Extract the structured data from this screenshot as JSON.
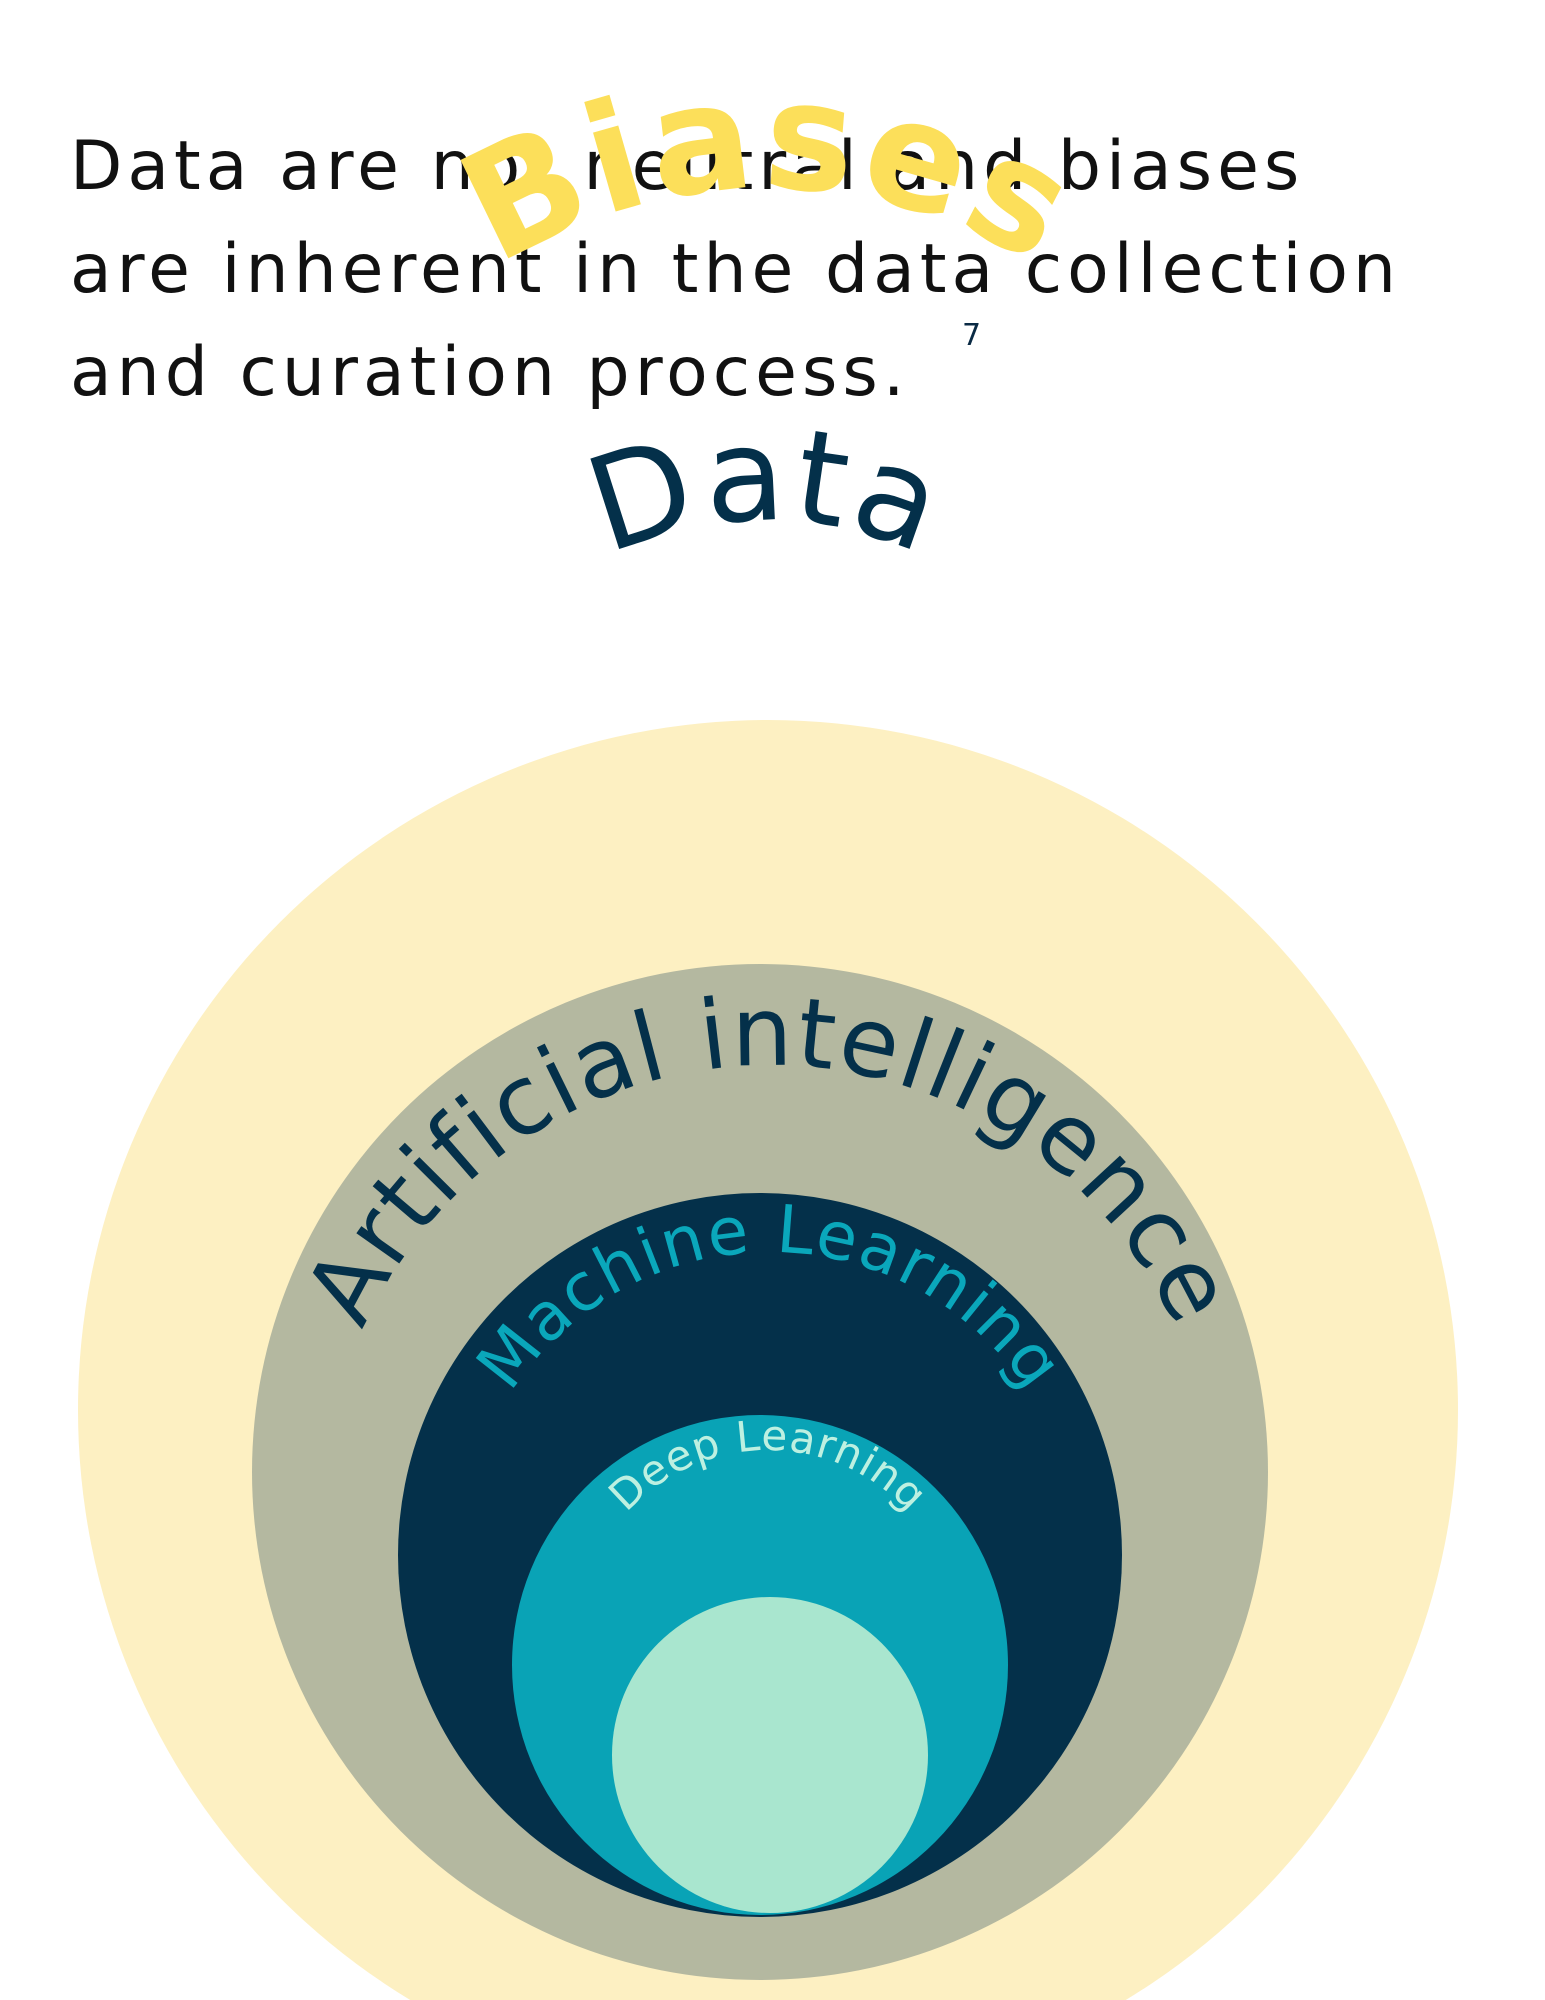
{
  "headline": {
    "line1": "Data are not neutral and biases",
    "line2": "are inherent in the data collection",
    "line3": "and curation process.",
    "footnote": "7"
  },
  "diagram": {
    "biases_label": "Biases",
    "data_label": "Data",
    "ai_label": "Artificial intelligence",
    "ml_label": "Machine Learning",
    "dl_label": "Deep Learning",
    "colors": {
      "biases": "#fcdf5a",
      "data_circle": "#fdf0c2",
      "ai_circle": "#b4b8a0",
      "ml_circle": "#04304a",
      "dl_circle": "#09a3b6",
      "inner_circle": "#a9e6cf",
      "dark_text": "#04304a",
      "ml_text": "#0aa7bb",
      "dl_text": "#bdf0e1"
    }
  }
}
